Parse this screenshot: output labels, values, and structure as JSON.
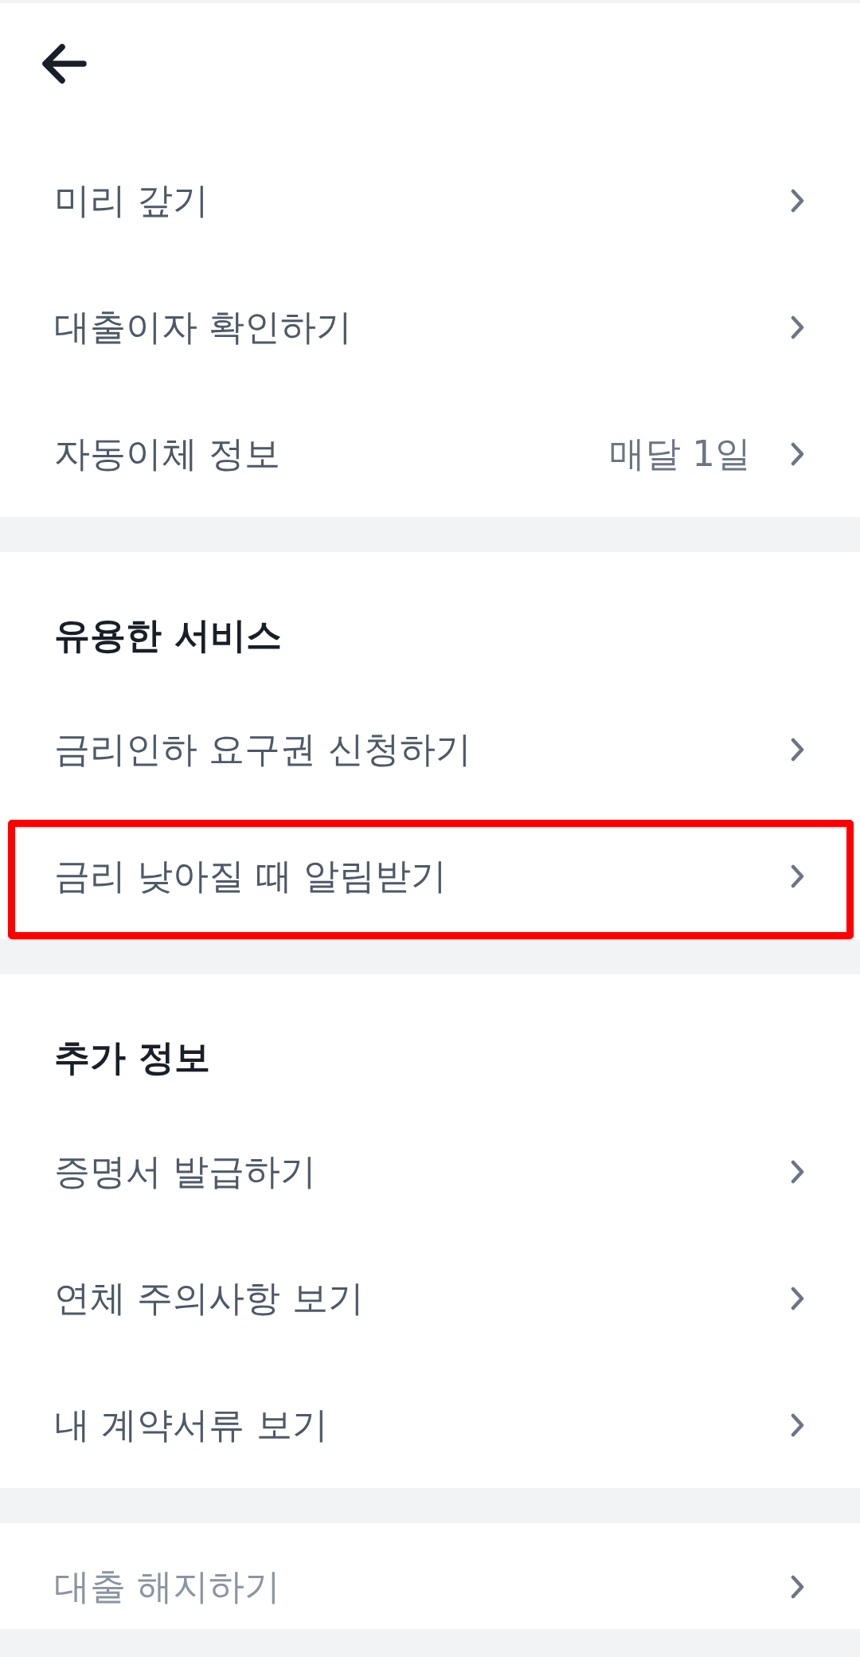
{
  "sections": [
    {
      "items": [
        {
          "label": "미리 갚기",
          "kind": "link",
          "highlighted": false
        },
        {
          "label": "대출이자 확인하기",
          "kind": "link",
          "highlighted": false
        },
        {
          "label": "자동이체 정보",
          "value": "매달 1일",
          "kind": "link",
          "highlighted": false
        }
      ]
    },
    {
      "title": "유용한 서비스",
      "items": [
        {
          "label": "금리인하 요구권 신청하기",
          "kind": "link",
          "highlighted": false
        },
        {
          "label": "금리 낮아질 때 알림받기",
          "kind": "link",
          "highlighted": true
        }
      ]
    },
    {
      "title": "추가 정보",
      "items": [
        {
          "label": "증명서 발급하기",
          "kind": "link",
          "highlighted": false
        },
        {
          "label": "연체 주의사항 보기",
          "kind": "link",
          "highlighted": false
        },
        {
          "label": "내 계약서류 보기",
          "kind": "link",
          "highlighted": false
        }
      ]
    },
    {
      "items": [
        {
          "label": "대출 해지하기",
          "kind": "muted",
          "highlighted": false
        }
      ]
    }
  ]
}
